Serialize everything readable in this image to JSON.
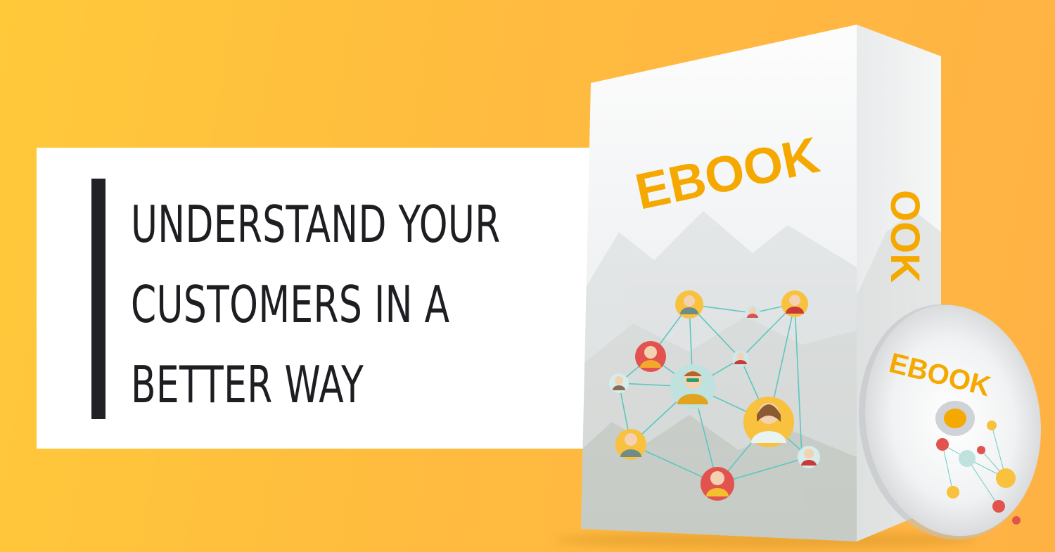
{
  "headline": {
    "lines": [
      "UNDERSTAND YOUR",
      "CUSTOMERS IN A",
      "BETTER WAY"
    ]
  },
  "product": {
    "box_title": "EBOOK",
    "spine_title": "OOK",
    "disc_title": "EBOOK"
  },
  "colors": {
    "background": "#ffbd3f",
    "accent_bar": "#222226",
    "brand_orange": "#f5a900",
    "network_line": "#5cc7bf"
  }
}
